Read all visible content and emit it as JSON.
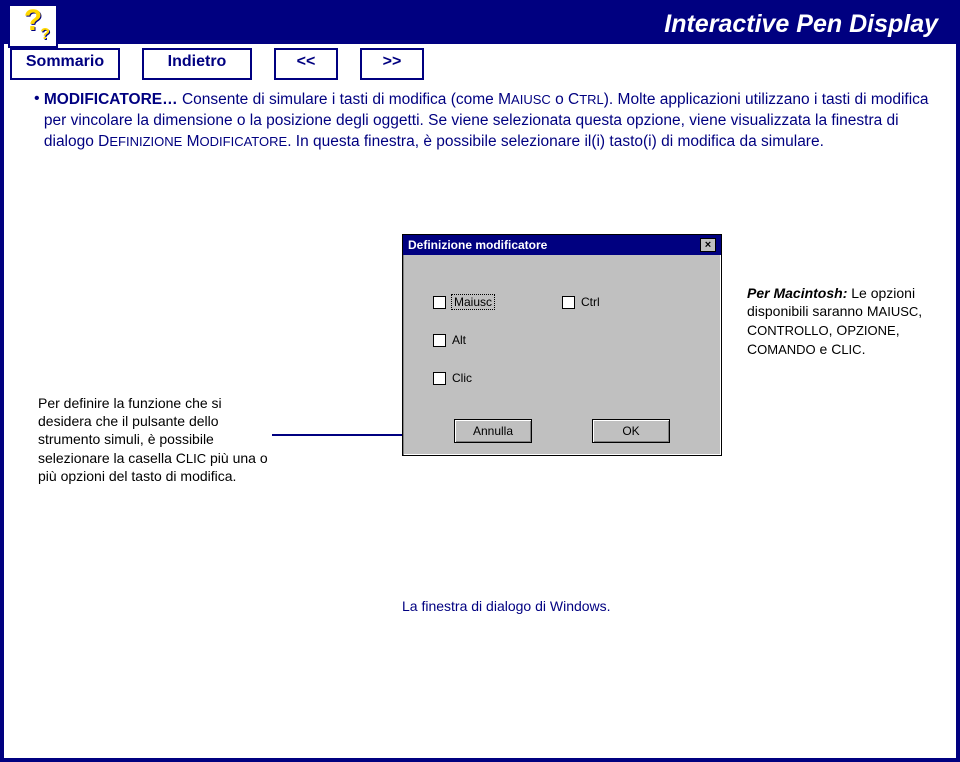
{
  "brand": "Interactive Pen Display",
  "nav": {
    "summary": "Sommario",
    "back": "Indietro",
    "prev": "<<",
    "next": ">>"
  },
  "help_icon": {
    "big": "?",
    "small": "?"
  },
  "body": {
    "heading": "MODIFICATORE…",
    "text1": " Consente di simulare i tasti di modifica (come ",
    "sc1_a": "M",
    "sc1_b": "AIUSC",
    "text2": " o ",
    "sc2_a": "C",
    "sc2_b": "TRL",
    "text3": "). Molte applicazioni utilizzano i tasti di modifica per vincolare la dimensione o la posizione degli oggetti. Se viene selezionata questa opzione, viene visualizzata la finestra di dialogo ",
    "sc3_a": "D",
    "sc3_b": "EFINIZIONE",
    "sc4_a": " M",
    "sc4_b": "ODIFICATORE",
    "text4": ". In questa finestra, è possibile selezionare il(i) tasto(i) di modifica da simulare."
  },
  "leftnote": {
    "t1": "Per definire la funzione che si desidera che il pulsante dello strumento simuli, è possibile selezionare la casella ",
    "sc_a": "C",
    "sc_b": "LIC",
    "t2": " più una o più opzioni del tasto di modifica."
  },
  "rightnote": {
    "lead": "Per Macintosh:",
    "t1": " Le opzioni disponibili saranno ",
    "sc1_a": "M",
    "sc1_b": "AIUSC",
    "sep1": ", ",
    "sc2_a": "C",
    "sc2_b": "ONTROLLO",
    "sep2": ", ",
    "sc3_a": "O",
    "sc3_b": "PZIONE",
    "sep3": ", ",
    "sc4_a": "C",
    "sc4_b": "OMANDO",
    "t2": " e ",
    "sc5_a": "C",
    "sc5_b": "LIC",
    "t3": "."
  },
  "dialog": {
    "title": "Definizione modificatore",
    "close": "×",
    "maiusc": "Maiusc",
    "ctrl": "Ctrl",
    "alt": "Alt",
    "clic": "Clic",
    "cancel": "Annulla",
    "ok": "OK"
  },
  "caption": "La finestra di dialogo di Windows."
}
